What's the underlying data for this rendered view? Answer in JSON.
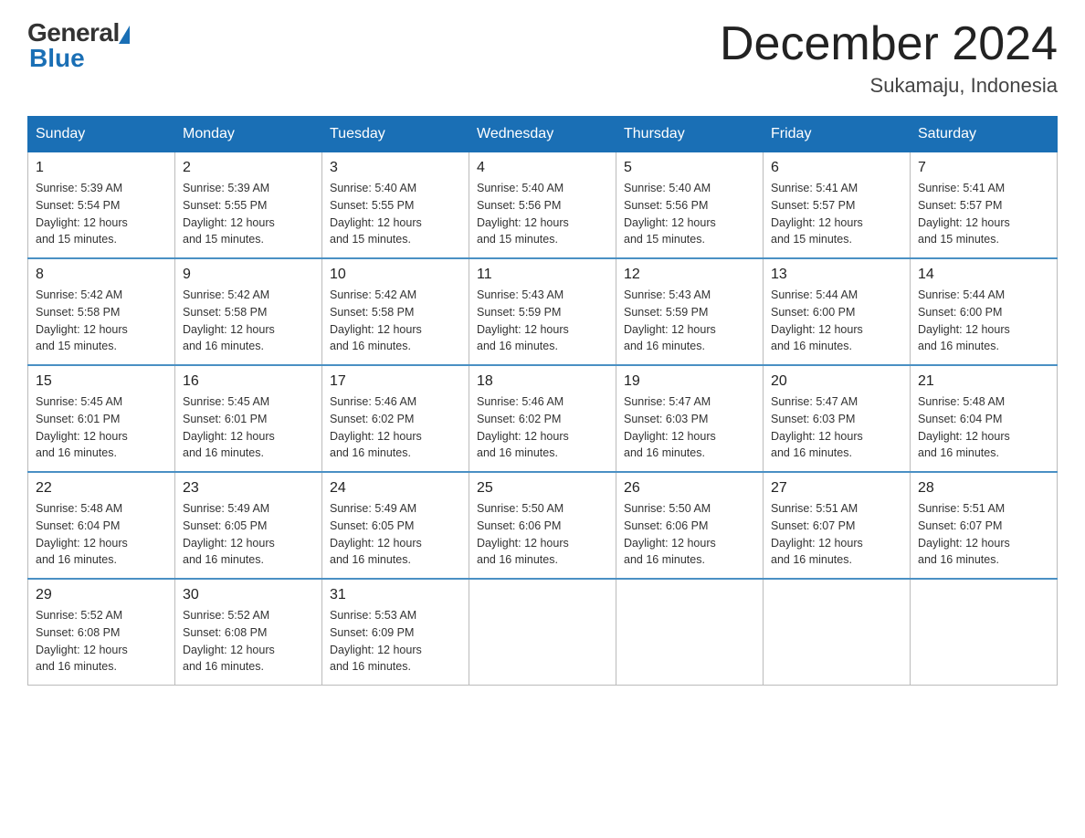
{
  "header": {
    "logo_general": "General",
    "logo_blue": "Blue",
    "title": "December 2024",
    "location": "Sukamaju, Indonesia"
  },
  "days_of_week": [
    "Sunday",
    "Monday",
    "Tuesday",
    "Wednesday",
    "Thursday",
    "Friday",
    "Saturday"
  ],
  "weeks": [
    [
      {
        "day": "1",
        "sunrise": "5:39 AM",
        "sunset": "5:54 PM",
        "daylight": "12 hours and 15 minutes."
      },
      {
        "day": "2",
        "sunrise": "5:39 AM",
        "sunset": "5:55 PM",
        "daylight": "12 hours and 15 minutes."
      },
      {
        "day": "3",
        "sunrise": "5:40 AM",
        "sunset": "5:55 PM",
        "daylight": "12 hours and 15 minutes."
      },
      {
        "day": "4",
        "sunrise": "5:40 AM",
        "sunset": "5:56 PM",
        "daylight": "12 hours and 15 minutes."
      },
      {
        "day": "5",
        "sunrise": "5:40 AM",
        "sunset": "5:56 PM",
        "daylight": "12 hours and 15 minutes."
      },
      {
        "day": "6",
        "sunrise": "5:41 AM",
        "sunset": "5:57 PM",
        "daylight": "12 hours and 15 minutes."
      },
      {
        "day": "7",
        "sunrise": "5:41 AM",
        "sunset": "5:57 PM",
        "daylight": "12 hours and 15 minutes."
      }
    ],
    [
      {
        "day": "8",
        "sunrise": "5:42 AM",
        "sunset": "5:58 PM",
        "daylight": "12 hours and 15 minutes."
      },
      {
        "day": "9",
        "sunrise": "5:42 AM",
        "sunset": "5:58 PM",
        "daylight": "12 hours and 16 minutes."
      },
      {
        "day": "10",
        "sunrise": "5:42 AM",
        "sunset": "5:58 PM",
        "daylight": "12 hours and 16 minutes."
      },
      {
        "day": "11",
        "sunrise": "5:43 AM",
        "sunset": "5:59 PM",
        "daylight": "12 hours and 16 minutes."
      },
      {
        "day": "12",
        "sunrise": "5:43 AM",
        "sunset": "5:59 PM",
        "daylight": "12 hours and 16 minutes."
      },
      {
        "day": "13",
        "sunrise": "5:44 AM",
        "sunset": "6:00 PM",
        "daylight": "12 hours and 16 minutes."
      },
      {
        "day": "14",
        "sunrise": "5:44 AM",
        "sunset": "6:00 PM",
        "daylight": "12 hours and 16 minutes."
      }
    ],
    [
      {
        "day": "15",
        "sunrise": "5:45 AM",
        "sunset": "6:01 PM",
        "daylight": "12 hours and 16 minutes."
      },
      {
        "day": "16",
        "sunrise": "5:45 AM",
        "sunset": "6:01 PM",
        "daylight": "12 hours and 16 minutes."
      },
      {
        "day": "17",
        "sunrise": "5:46 AM",
        "sunset": "6:02 PM",
        "daylight": "12 hours and 16 minutes."
      },
      {
        "day": "18",
        "sunrise": "5:46 AM",
        "sunset": "6:02 PM",
        "daylight": "12 hours and 16 minutes."
      },
      {
        "day": "19",
        "sunrise": "5:47 AM",
        "sunset": "6:03 PM",
        "daylight": "12 hours and 16 minutes."
      },
      {
        "day": "20",
        "sunrise": "5:47 AM",
        "sunset": "6:03 PM",
        "daylight": "12 hours and 16 minutes."
      },
      {
        "day": "21",
        "sunrise": "5:48 AM",
        "sunset": "6:04 PM",
        "daylight": "12 hours and 16 minutes."
      }
    ],
    [
      {
        "day": "22",
        "sunrise": "5:48 AM",
        "sunset": "6:04 PM",
        "daylight": "12 hours and 16 minutes."
      },
      {
        "day": "23",
        "sunrise": "5:49 AM",
        "sunset": "6:05 PM",
        "daylight": "12 hours and 16 minutes."
      },
      {
        "day": "24",
        "sunrise": "5:49 AM",
        "sunset": "6:05 PM",
        "daylight": "12 hours and 16 minutes."
      },
      {
        "day": "25",
        "sunrise": "5:50 AM",
        "sunset": "6:06 PM",
        "daylight": "12 hours and 16 minutes."
      },
      {
        "day": "26",
        "sunrise": "5:50 AM",
        "sunset": "6:06 PM",
        "daylight": "12 hours and 16 minutes."
      },
      {
        "day": "27",
        "sunrise": "5:51 AM",
        "sunset": "6:07 PM",
        "daylight": "12 hours and 16 minutes."
      },
      {
        "day": "28",
        "sunrise": "5:51 AM",
        "sunset": "6:07 PM",
        "daylight": "12 hours and 16 minutes."
      }
    ],
    [
      {
        "day": "29",
        "sunrise": "5:52 AM",
        "sunset": "6:08 PM",
        "daylight": "12 hours and 16 minutes."
      },
      {
        "day": "30",
        "sunrise": "5:52 AM",
        "sunset": "6:08 PM",
        "daylight": "12 hours and 16 minutes."
      },
      {
        "day": "31",
        "sunrise": "5:53 AM",
        "sunset": "6:09 PM",
        "daylight": "12 hours and 16 minutes."
      },
      null,
      null,
      null,
      null
    ]
  ],
  "labels": {
    "sunrise_prefix": "Sunrise: ",
    "sunset_prefix": "Sunset: ",
    "daylight_prefix": "Daylight: "
  }
}
